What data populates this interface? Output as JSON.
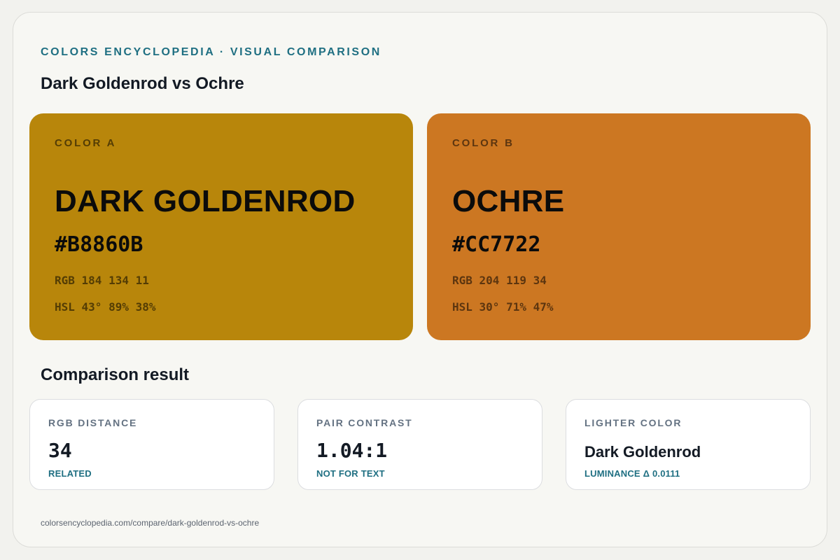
{
  "header": {
    "eyebrow": "COLORS ENCYCLOPEDIA · VISUAL COMPARISON",
    "title": "Dark Goldenrod vs Ochre"
  },
  "colors": [
    {
      "kicker": "COLOR A",
      "name": "DARK GOLDENROD",
      "hex": "#B8860B",
      "rgb": "RGB 184 134 11",
      "hsl": "HSL 43° 89% 38%",
      "swatch_color": "#B8860B"
    },
    {
      "kicker": "COLOR B",
      "name": "OCHRE",
      "hex": "#CC7722",
      "rgb": "RGB 204 119 34",
      "hsl": "HSL 30° 71% 47%",
      "swatch_color": "#CC7722"
    }
  ],
  "comparison": {
    "title": "Comparison result",
    "stats": [
      {
        "label": "RGB DISTANCE",
        "value": "34",
        "note": "RELATED"
      },
      {
        "label": "PAIR CONTRAST",
        "value": "1.04:1",
        "note": "NOT FOR TEXT"
      },
      {
        "label": "LIGHTER COLOR",
        "value": "Dark Goldenrod",
        "note": "LUMINANCE Δ 0.0111"
      }
    ]
  },
  "footer": {
    "url": "colorsencyclopedia.com/compare/dark-goldenrod-vs-ochre"
  },
  "theme": {
    "accent": "#1F6F82",
    "page_bg": "#F7F7F3",
    "text_dark": "#131A24",
    "label_gray": "#647282"
  }
}
